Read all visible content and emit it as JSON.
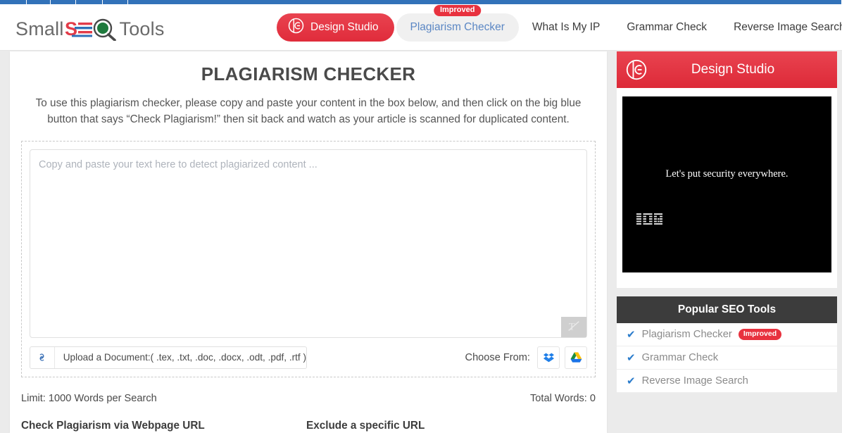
{
  "browser": {
    "loading_strip_color": "#3272b9",
    "segments": 6
  },
  "header": {
    "logo": {
      "part1": "Small",
      "part2": "SEO",
      "part3": "Tools",
      "icon": "magnifier-logo-icon"
    },
    "nav": {
      "design_studio": "Design Studio",
      "plagiarism_checker": "Plagiarism Checker",
      "plagiarism_badge": "Improved",
      "what_is_my_ip": "What Is My IP",
      "grammar_check": "Grammar Check",
      "reverse_image_search": "Reverse Image Search",
      "search_icon": "search-icon"
    }
  },
  "main": {
    "title": "PLAGIARISM CHECKER",
    "description": "To use this plagiarism checker, please copy and paste your content in the box below, and then click on the big blue button that says “Check Plagiarism!” then sit back and watch as your article is scanned for duplicated content.",
    "editor": {
      "placeholder": "Copy and paste your text here to detect plagiarized content ...",
      "value": "",
      "grammar_icon": "grammar-check-icon"
    },
    "upload": {
      "link_icon": "link-icon",
      "label": "Upload a Document:( .tex, .txt, .doc, .docx, .odt, .pdf, .rtf )"
    },
    "choose_from": {
      "label": "Choose From:",
      "dropbox_icon": "dropbox-icon",
      "google_drive_icon": "google-drive-icon"
    },
    "limit_text": "Limit: 1000 Words per Search",
    "total_words_text": "Total Words: 0",
    "webpage_url_label": "Check Plagiarism via Webpage URL",
    "exclude_url_label": "Exclude a specific URL"
  },
  "sidebar": {
    "design_studio": {
      "title": "Design Studio",
      "logo_icon": "design-studio-logo-icon",
      "header_color": "#e23c49"
    },
    "ad": {
      "text": "Let's put security everywhere.",
      "brand": "IBM"
    },
    "popular": {
      "title": "Popular SEO Tools",
      "items": [
        {
          "label": "Plagiarism Checker",
          "badge": "Improved"
        },
        {
          "label": "Grammar Check",
          "badge": ""
        },
        {
          "label": "Reverse Image Search",
          "badge": ""
        }
      ]
    }
  },
  "colors": {
    "brand_red": "#e23c49",
    "accent_blue": "#2b7ccc",
    "dark_panel": "#3c3c3c"
  }
}
